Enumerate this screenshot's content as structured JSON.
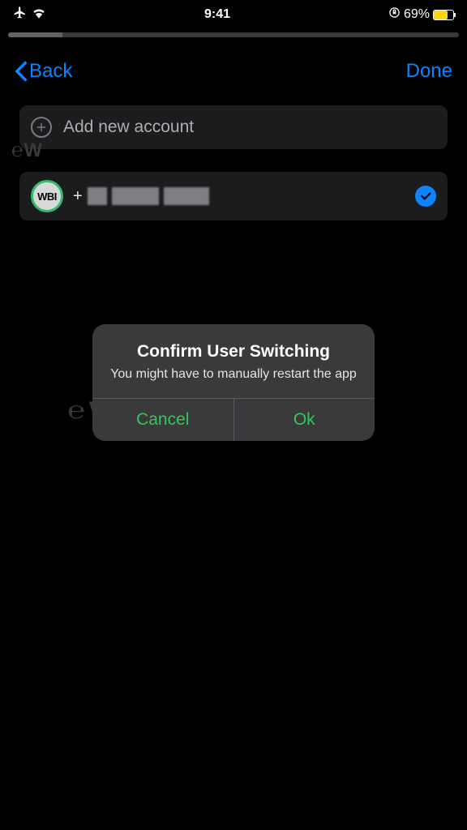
{
  "statusBar": {
    "time": "9:41",
    "batteryPct": "69%"
  },
  "nav": {
    "back": "Back",
    "done": "Done"
  },
  "addAccount": {
    "label": "Add new account"
  },
  "account": {
    "avatar": "WBI",
    "plus": "+"
  },
  "dialog": {
    "title": "Confirm User Switching",
    "message": "You might have to manually restart the app",
    "cancel": "Cancel",
    "ok": "Ok"
  },
  "watermarks": {
    "w1": "℮W",
    "w2": "℮WA...A.."
  }
}
